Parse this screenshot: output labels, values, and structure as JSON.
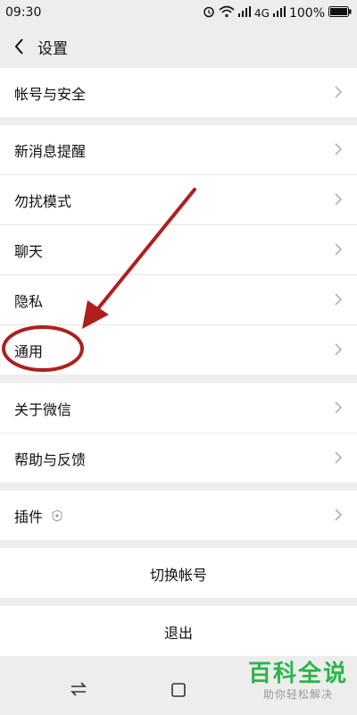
{
  "status": {
    "time": "09:30",
    "battery": "100%",
    "network": "4G"
  },
  "nav": {
    "title": "设置"
  },
  "groups": {
    "account": [
      "帐号与安全"
    ],
    "main": [
      "新消息提醒",
      "勿扰模式",
      "聊天",
      "隐私",
      "通用"
    ],
    "about": [
      "关于微信",
      "帮助与反馈"
    ],
    "plugins": [
      "插件"
    ]
  },
  "buttons": {
    "switch_account": "切换帐号",
    "logout": "退出"
  },
  "watermark": {
    "title": "百科全说",
    "subtitle": "助你轻松解决"
  },
  "colors": {
    "annotation": "#b01e1e",
    "watermark": "#2bb54a",
    "background": "#ededed"
  }
}
